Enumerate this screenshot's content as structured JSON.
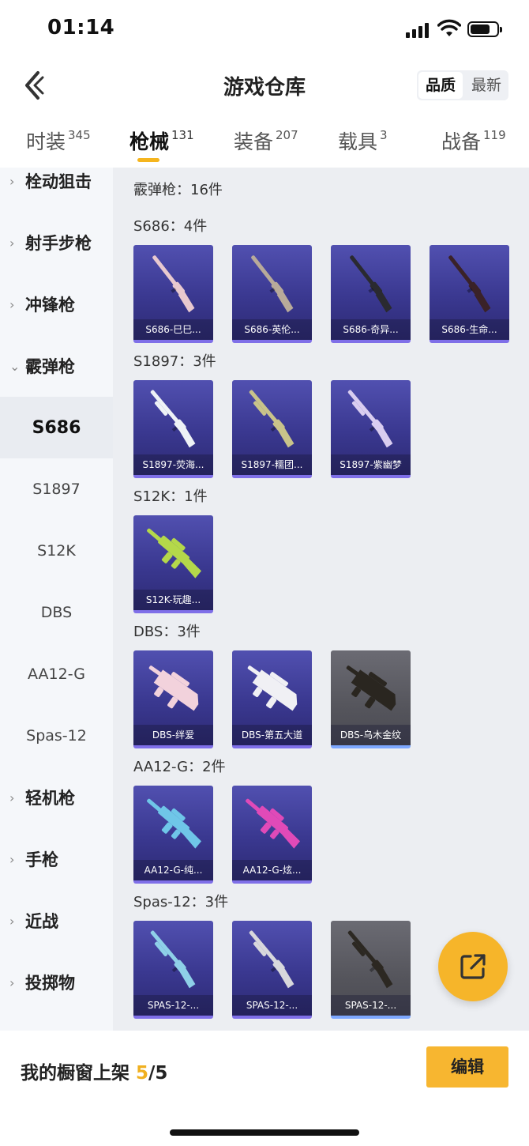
{
  "status": {
    "time": "01:14"
  },
  "header": {
    "title": "游戏仓库",
    "sort_quality": "品质",
    "sort_newest": "最新"
  },
  "tabs": [
    {
      "label": "时装",
      "count": "345"
    },
    {
      "label": "枪械",
      "count": "131"
    },
    {
      "label": "装备",
      "count": "207"
    },
    {
      "label": "载具",
      "count": "3"
    },
    {
      "label": "战备",
      "count": "119"
    }
  ],
  "sidebar": [
    {
      "label": "栓动狙击",
      "type": "cat",
      "chevron": "›"
    },
    {
      "label": "射手步枪",
      "type": "cat",
      "chevron": "›"
    },
    {
      "label": "冲锋枪",
      "type": "cat",
      "chevron": "›"
    },
    {
      "label": "霰弹枪",
      "type": "cat",
      "chevron": "⌄"
    },
    {
      "label": "S686",
      "type": "sub",
      "active": true
    },
    {
      "label": "S1897",
      "type": "sub"
    },
    {
      "label": "S12K",
      "type": "sub"
    },
    {
      "label": "DBS",
      "type": "sub"
    },
    {
      "label": "AA12-G",
      "type": "sub"
    },
    {
      "label": "Spas-12",
      "type": "sub"
    },
    {
      "label": "轻机枪",
      "type": "cat",
      "chevron": "›"
    },
    {
      "label": "手枪",
      "type": "cat",
      "chevron": "›"
    },
    {
      "label": "近战",
      "type": "cat",
      "chevron": "›"
    },
    {
      "label": "投掷物",
      "type": "cat",
      "chevron": "›"
    }
  ],
  "content": {
    "summary": "霰弹枪：16件",
    "sections": [
      {
        "title": "S686：4件",
        "items": [
          {
            "label": "S686-巳巳...",
            "quality": "purple",
            "gun": "shotgun",
            "color": "#e8c9cf"
          },
          {
            "label": "S686-英伦...",
            "quality": "purple",
            "gun": "shotgun",
            "color": "#b8aa9a"
          },
          {
            "label": "S686-奇异...",
            "quality": "purple",
            "gun": "shotgun",
            "color": "#2a2a30"
          },
          {
            "label": "S686-生命...",
            "quality": "purple",
            "gun": "shotgun",
            "color": "#3a2228"
          }
        ]
      },
      {
        "title": "S1897：3件",
        "items": [
          {
            "label": "S1897-荧海...",
            "quality": "purple",
            "gun": "pump",
            "color": "#eef2f6"
          },
          {
            "label": "S1897-糯团...",
            "quality": "purple",
            "gun": "pump",
            "color": "#c9c38a"
          },
          {
            "label": "S1897-紫幽梦",
            "quality": "purple",
            "gun": "pump",
            "color": "#d9cdf0"
          }
        ]
      },
      {
        "title": "S12K：1件",
        "items": [
          {
            "label": "S12K-玩趣...",
            "quality": "purple",
            "gun": "rifle",
            "color": "#b4d84a"
          }
        ]
      },
      {
        "title": "DBS：3件",
        "items": [
          {
            "label": "DBS-绊爱",
            "quality": "purple",
            "gun": "bullpup",
            "color": "#f2d2dc"
          },
          {
            "label": "DBS-第五大道",
            "quality": "purple",
            "gun": "bullpup",
            "color": "#f0f0f4"
          },
          {
            "label": "DBS-乌木金纹",
            "quality": "gray",
            "gun": "bullpup",
            "color": "#2a2620"
          }
        ]
      },
      {
        "title": "AA12-G：2件",
        "items": [
          {
            "label": "AA12-G-纯...",
            "quality": "purple",
            "gun": "rifle",
            "color": "#6fc6e8"
          },
          {
            "label": "AA12-G-炫...",
            "quality": "purple",
            "gun": "rifle",
            "color": "#e04ab8"
          }
        ]
      },
      {
        "title": "Spas-12：3件",
        "items": [
          {
            "label": "SPAS-12-...",
            "quality": "purple",
            "gun": "pump",
            "color": "#8fd0e8"
          },
          {
            "label": "SPAS-12-...",
            "quality": "purple",
            "gun": "pump",
            "color": "#d8d8dc"
          },
          {
            "label": "SPAS-12-...",
            "quality": "gray",
            "gun": "pump",
            "color": "#2c2822"
          }
        ]
      }
    ]
  },
  "fab_icon": "share-external-icon",
  "bottom": {
    "shelf_label": "我的橱窗上架",
    "shelf_current": "5",
    "shelf_total": "/5",
    "edit_label": "编辑"
  },
  "colors": {
    "accent": "#f5b51e",
    "card_purple": "#3a3890",
    "card_gray": "#55555c"
  }
}
